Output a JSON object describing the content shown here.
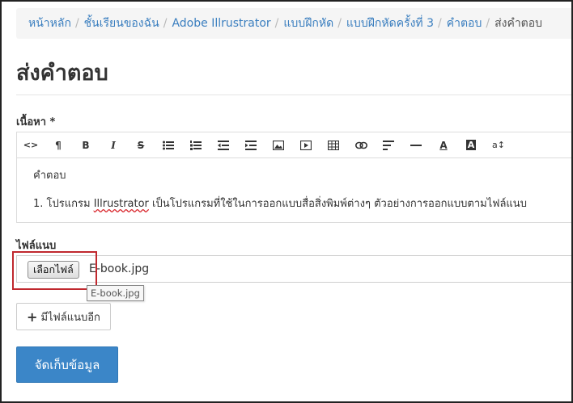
{
  "breadcrumb": [
    {
      "label": "หน้าหลัก",
      "link": true
    },
    {
      "label": "ชั้นเรียนของฉัน",
      "link": true
    },
    {
      "label": "Adobe Illrustrator",
      "link": true
    },
    {
      "label": "แบบฝึกหัด",
      "link": true
    },
    {
      "label": "แบบฝึกหัดครั้งที่ 3",
      "link": true
    },
    {
      "label": "คำตอบ",
      "link": true
    },
    {
      "label": "ส่งคำตอบ",
      "link": false
    }
  ],
  "page": {
    "title": "ส่งคำตอบ"
  },
  "content_field": {
    "label": "เนื้อหา *",
    "toolbar": [
      {
        "name": "code-view-icon",
        "glyph": "<>"
      },
      {
        "name": "paragraph-icon",
        "glyph": "¶"
      },
      {
        "name": "bold-icon",
        "glyph": "B"
      },
      {
        "name": "italic-icon",
        "glyph": "I"
      },
      {
        "name": "strikethrough-icon",
        "glyph": "S"
      },
      {
        "name": "bulleted-list-icon",
        "glyph": ""
      },
      {
        "name": "numbered-list-icon",
        "glyph": ""
      },
      {
        "name": "outdent-icon",
        "glyph": ""
      },
      {
        "name": "indent-icon",
        "glyph": ""
      },
      {
        "name": "image-icon",
        "glyph": ""
      },
      {
        "name": "video-icon",
        "glyph": ""
      },
      {
        "name": "table-icon",
        "glyph": ""
      },
      {
        "name": "link-icon",
        "glyph": ""
      },
      {
        "name": "align-icon",
        "glyph": ""
      },
      {
        "name": "horizontal-rule-icon",
        "glyph": ""
      },
      {
        "name": "font-color-icon",
        "glyph": "A"
      },
      {
        "name": "background-color-icon",
        "glyph": "A"
      },
      {
        "name": "font-size-icon",
        "glyph": "a↕"
      }
    ],
    "lines": {
      "line1": "คำตอบ",
      "line2_prefix": "1. โปรแกรม ",
      "line2_misspelled": "Illrustrator",
      "line2_suffix": " เป็นโปรแกรมที่ใช้ในการออกแบบสื่อสิ่งพิมพ์ต่างๆ ตัวอย่างการออกแบบตามไฟล์แนบ"
    }
  },
  "attachment": {
    "label": "ไฟล์แนบ",
    "choose_button": "เลือกไฟล์",
    "file_name": "E-book.jpg",
    "tooltip": "E-book.jpg"
  },
  "buttons": {
    "add_more_plus": "+",
    "add_more": "มีไฟล์แนบอีก",
    "save": "จัดเก็บข้อมูล"
  },
  "colors": {
    "link": "#3a7ebf",
    "primary": "#3b86c8",
    "highlight": "#c0282e"
  }
}
